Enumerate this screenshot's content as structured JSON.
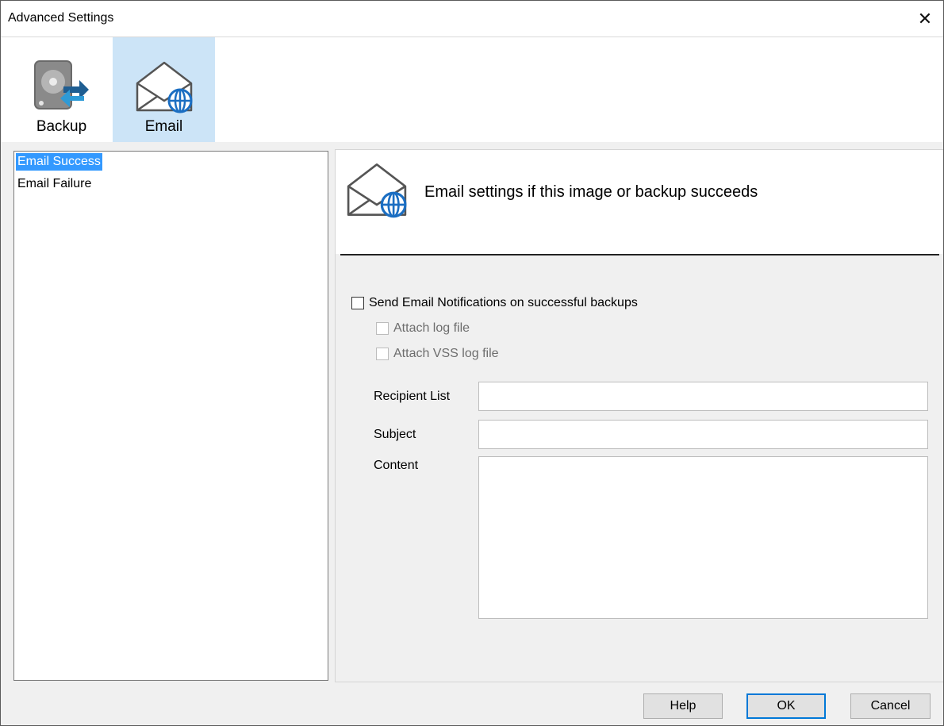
{
  "window": {
    "title": "Advanced Settings",
    "close_glyph": "✕"
  },
  "toolbar": {
    "items": [
      {
        "label": "Backup",
        "icon": "disk-sync-icon",
        "active": false
      },
      {
        "label": "Email",
        "icon": "envelope-globe-icon",
        "active": true
      }
    ]
  },
  "sidebar": {
    "items": [
      {
        "label": "Email Success",
        "selected": true
      },
      {
        "label": "Email Failure",
        "selected": false
      }
    ]
  },
  "panel": {
    "heading": "Email settings if this image or backup succeeds",
    "icon": "envelope-globe-icon",
    "send_notifications": {
      "label": "Send Email Notifications on successful backups",
      "checked": false
    },
    "attach_log": {
      "label": "Attach log file",
      "checked": false,
      "disabled": true
    },
    "attach_vss_log": {
      "label": "Attach VSS log file",
      "checked": false,
      "disabled": true
    },
    "fields": {
      "recipient_label": "Recipient List",
      "recipient_value": "",
      "subject_label": "Subject",
      "subject_value": "",
      "content_label": "Content",
      "content_value": ""
    }
  },
  "footer": {
    "help": "Help",
    "ok": "OK",
    "cancel": "Cancel"
  },
  "colors": {
    "selection": "#3399ff",
    "active_tool": "#cce4f7",
    "accent": "#0078d7"
  }
}
